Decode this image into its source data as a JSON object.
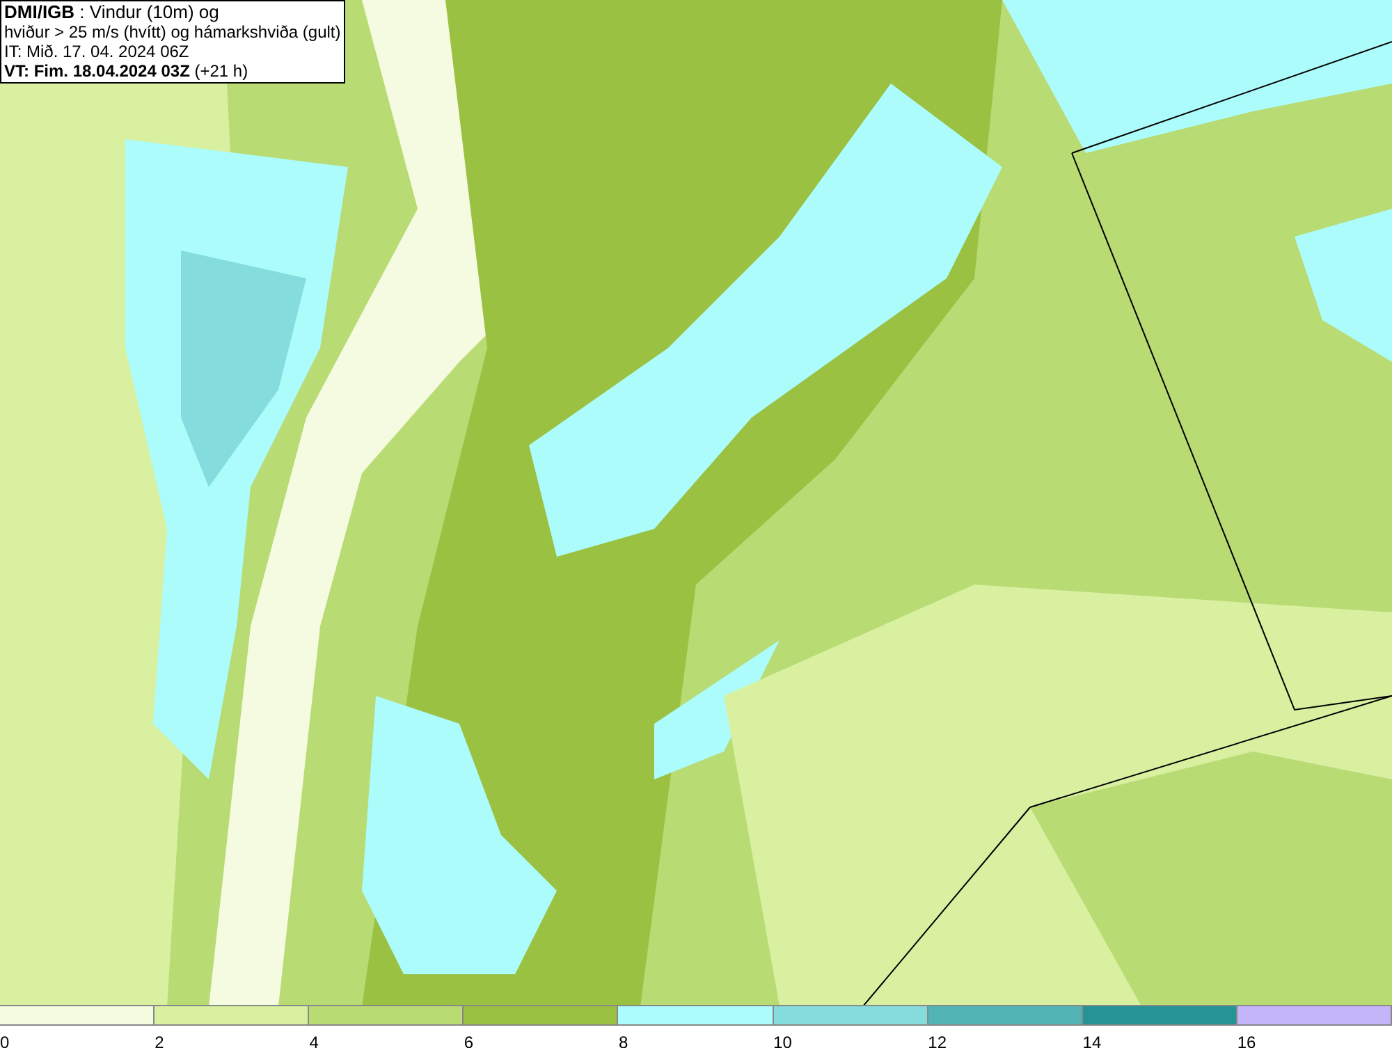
{
  "header": {
    "lines": [
      "**DMI/IGB** : Vindur (10m) og",
      "hviður > 25 m/s (hvítt) og hámarkshviða (gult)",
      "IT: Mið. 17. 04. 2024 06Z",
      "**VT: Fim. 18.04.2024 03Z** (+21 h)"
    ]
  },
  "legend": [
    {
      "label": "0",
      "color": "#f5fbe0"
    },
    {
      "label": "2",
      "color": "#d8f0a0"
    },
    {
      "label": "4",
      "color": "#b8db74"
    },
    {
      "label": "6",
      "color": "#9bc142"
    },
    {
      "label": "8",
      "color": "#acfcfc"
    },
    {
      "label": "10",
      "color": "#84dcdc"
    },
    {
      "label": "12",
      "color": "#52b4b4"
    },
    {
      "label": "14",
      "color": "#249494"
    },
    {
      "label": "16",
      "color": "#c4b4f8"
    }
  ]
}
